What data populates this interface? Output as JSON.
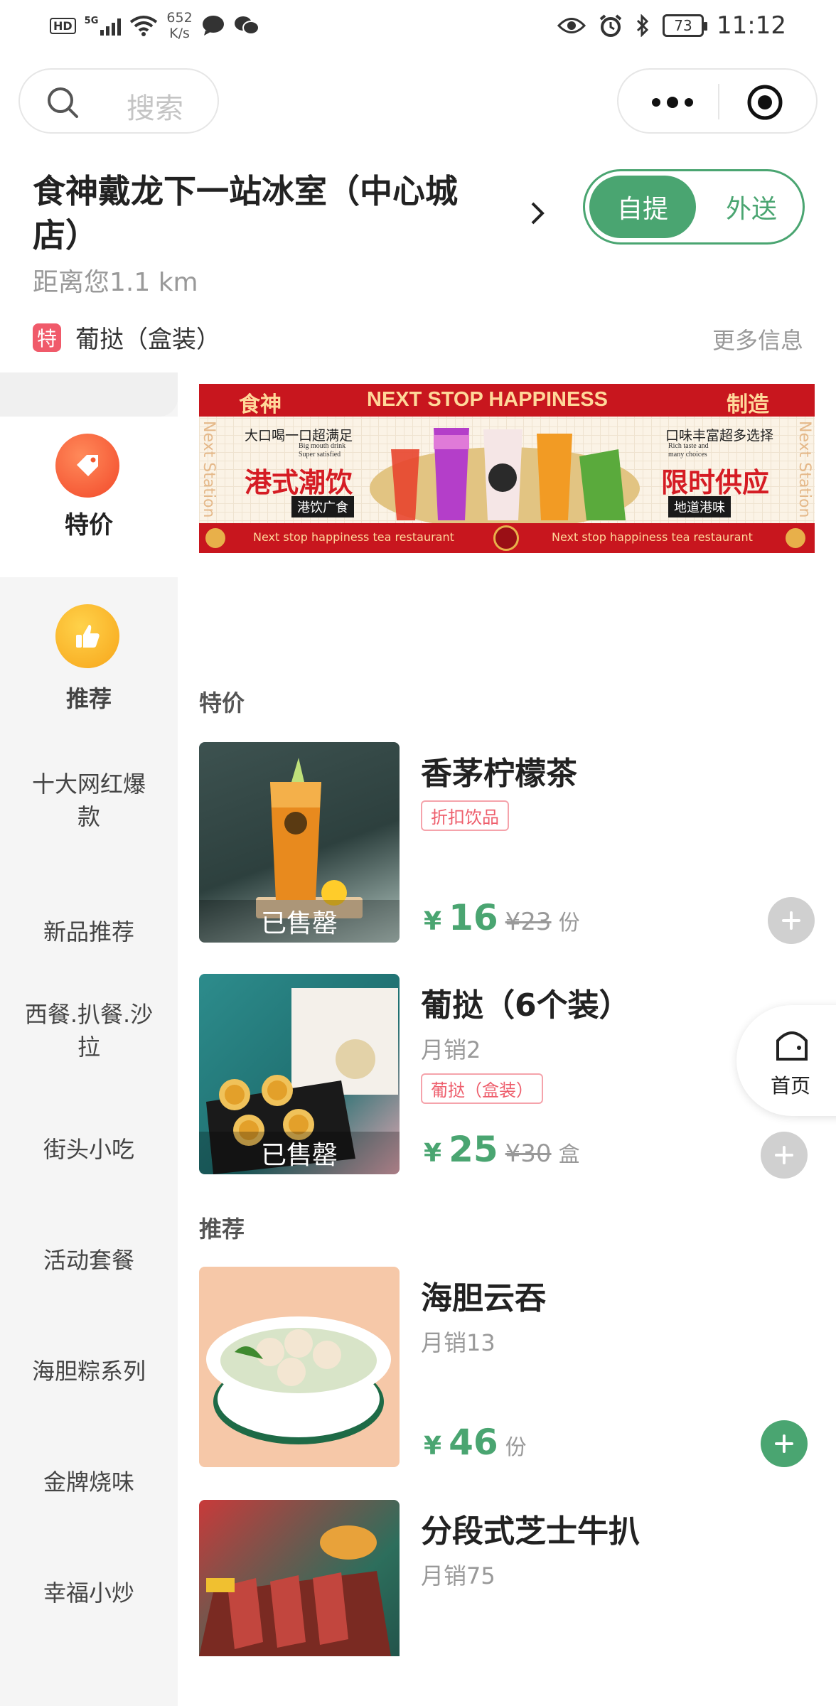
{
  "status_bar": {
    "hd": "HD",
    "signal": "5G",
    "speed_value": "652",
    "speed_unit": "K/s",
    "battery": "73",
    "time": "11:12"
  },
  "search": {
    "placeholder": "搜索"
  },
  "store": {
    "name": "食神戴龙下一站冰室（中心城店）",
    "distance": "距离您1.1 km",
    "mode_pickup": "自提",
    "mode_delivery": "外送",
    "promo_badge": "特",
    "promo_text": "葡挞（盒装）",
    "more_info": "更多信息"
  },
  "banner": {
    "left_top": "食神",
    "title": "NEXT STOP HAPPINESS",
    "right_top": "制造",
    "side_text": "Next Station",
    "left_small": "大口喝一口超满足",
    "left_small_en1": "Big mouth drink",
    "left_small_en2": "Super satisfied",
    "left_big": "港式潮饮",
    "left_tag": "港饮广食",
    "right_small": "口味丰富超多选择",
    "right_small_en1": "Rich taste and",
    "right_small_en2": "many choices",
    "right_big": "限时供应",
    "right_tag": "地道港味",
    "bottom_left": "Next stop happiness tea restaurant",
    "bottom_right": "Next stop happiness tea restaurant"
  },
  "sidebar": {
    "items": [
      {
        "label": "特价",
        "icon": "tag-icon",
        "active": true
      },
      {
        "label": "推荐",
        "icon": "thumbs-up-icon",
        "active": false
      },
      {
        "label": "十大网红爆款",
        "active": false
      },
      {
        "label": "新品推荐",
        "active": false
      },
      {
        "label": "西餐.扒餐.沙拉",
        "active": false
      },
      {
        "label": "街头小吃",
        "active": false
      },
      {
        "label": "活动套餐",
        "active": false
      },
      {
        "label": "海胆粽系列",
        "active": false
      },
      {
        "label": "金牌烧味",
        "active": false
      },
      {
        "label": "幸福小炒",
        "active": false
      }
    ]
  },
  "sections": {
    "special": "特价",
    "recommend": "推荐"
  },
  "products": [
    {
      "name": "香茅柠檬茶",
      "tag": "折扣饮品",
      "price": "16",
      "old_price": "¥23",
      "unit": "份",
      "sold_out": "已售罄"
    },
    {
      "name": "葡挞（6个装）",
      "sales": "月销2",
      "tag": "葡挞（盒装）",
      "price": "25",
      "old_price": "¥30",
      "unit": "盒",
      "sold_out": "已售罄"
    },
    {
      "name": "海胆云吞",
      "sales": "月销13",
      "price": "46",
      "unit": "份"
    },
    {
      "name": "分段式芝士牛扒",
      "sales": "月销75"
    }
  ],
  "currency": "¥",
  "home_button": {
    "label": "首页"
  },
  "colors": {
    "accent": "#4aa571",
    "promo_red": "#f05a6a",
    "banner_red": "#c8161e"
  }
}
